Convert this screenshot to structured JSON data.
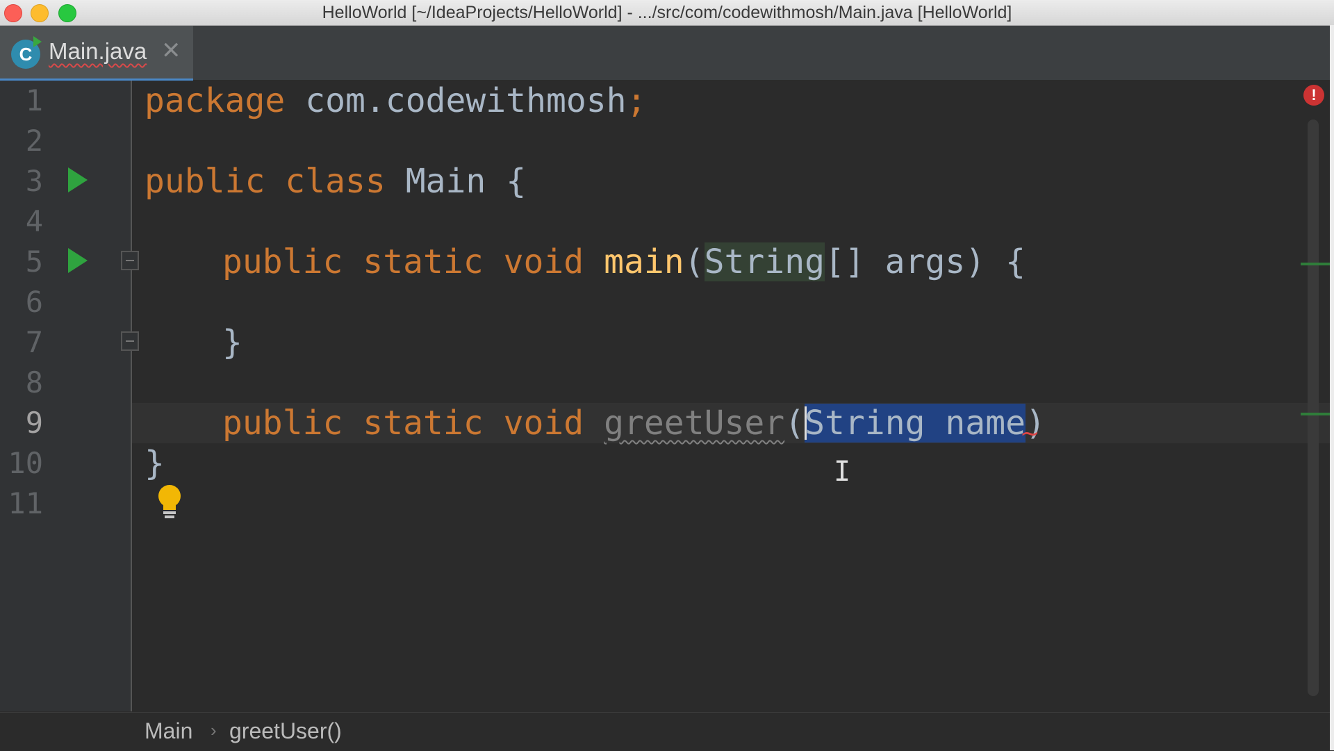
{
  "window": {
    "title": "HelloWorld [~/IdeaProjects/HelloWorld] - .../src/com/codewithmosh/Main.java [HelloWorld]"
  },
  "tabs": [
    {
      "label": "Main.java",
      "icon": "java-class-icon",
      "icon_letter": "C",
      "close": "✕"
    }
  ],
  "editor": {
    "line_numbers": [
      "1",
      "2",
      "3",
      "4",
      "5",
      "6",
      "7",
      "8",
      "9",
      "10",
      "11"
    ],
    "active_line": "9",
    "lines": {
      "l1": {
        "kw": "package",
        "rest": " com.codewithmosh",
        "semi": ";"
      },
      "l3": {
        "kw1": "public",
        "kw2": "class",
        "rest": " Main {"
      },
      "l5": {
        "kw1": "public",
        "kw2": "static",
        "kw3": "void",
        "fn": "main",
        "open": "(",
        "type": "String",
        "rest": "[] args) {"
      },
      "l7": {
        "rest": "}"
      },
      "l9": {
        "kw1": "public",
        "kw2": "static",
        "kw3": "void",
        "fn": "greetUser",
        "open": "(",
        "sel_first": "S",
        "sel_rest": "tring name",
        "close": ")"
      },
      "l10": {
        "rest": "}"
      }
    },
    "error_indicator": "!",
    "error_squiggle": "~",
    "mouse_cursor": "I"
  },
  "breadcrumb": {
    "items": [
      "Main",
      "greetUser()"
    ],
    "separator": "›"
  }
}
